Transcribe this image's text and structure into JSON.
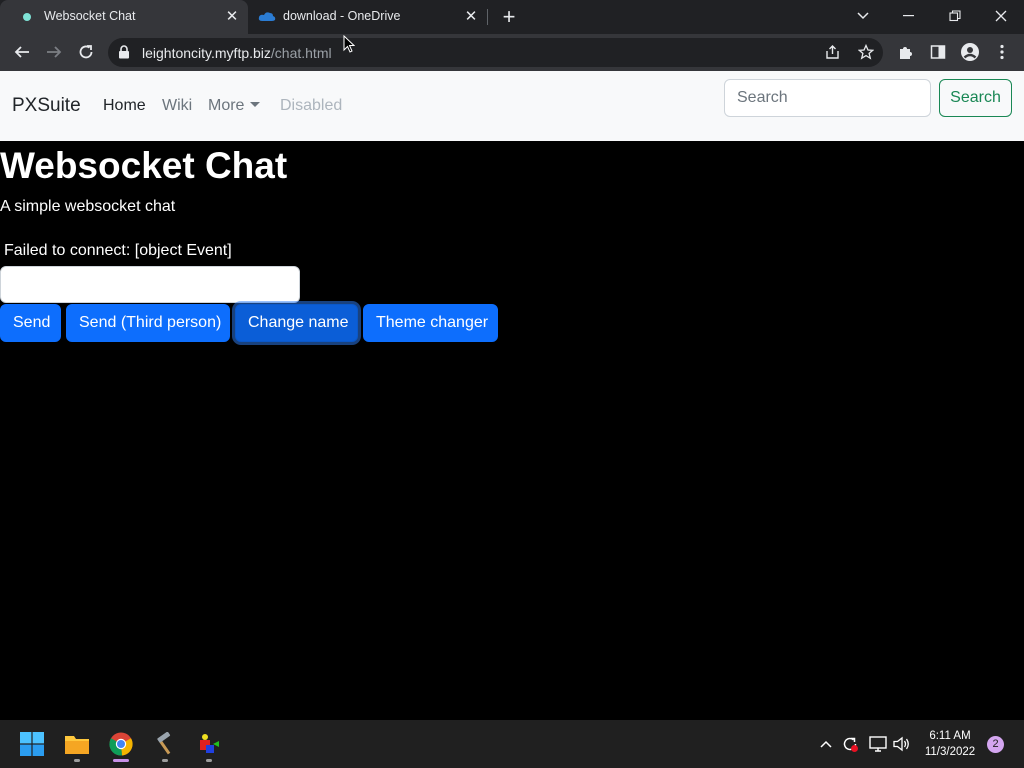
{
  "browser": {
    "tabs": [
      {
        "title": "Websocket Chat",
        "active": true
      },
      {
        "title": "download - OneDrive",
        "active": false
      }
    ],
    "url": {
      "host": "leightoncity.myftp.biz",
      "path": "/chat.html"
    }
  },
  "navbar": {
    "brand": "PXSuite",
    "links": [
      "Home",
      "Wiki",
      "More",
      "Disabled"
    ],
    "search_placeholder": "Search",
    "search_button": "Search"
  },
  "page": {
    "title": "Websocket Chat",
    "subtitle": "A simple websocket chat",
    "status": "Failed to connect: [object Event]",
    "message_value": "",
    "buttons": [
      "Send",
      "Send (Third person)",
      "Change name",
      "Theme changer"
    ]
  },
  "taskbar": {
    "time": "6:11 AM",
    "date": "11/3/2022",
    "notifications": "2"
  },
  "colors": {
    "primary": "#0d6efd",
    "success": "#198754",
    "navbar_bg": "#f8f9fa",
    "page_bg": "#000000"
  }
}
